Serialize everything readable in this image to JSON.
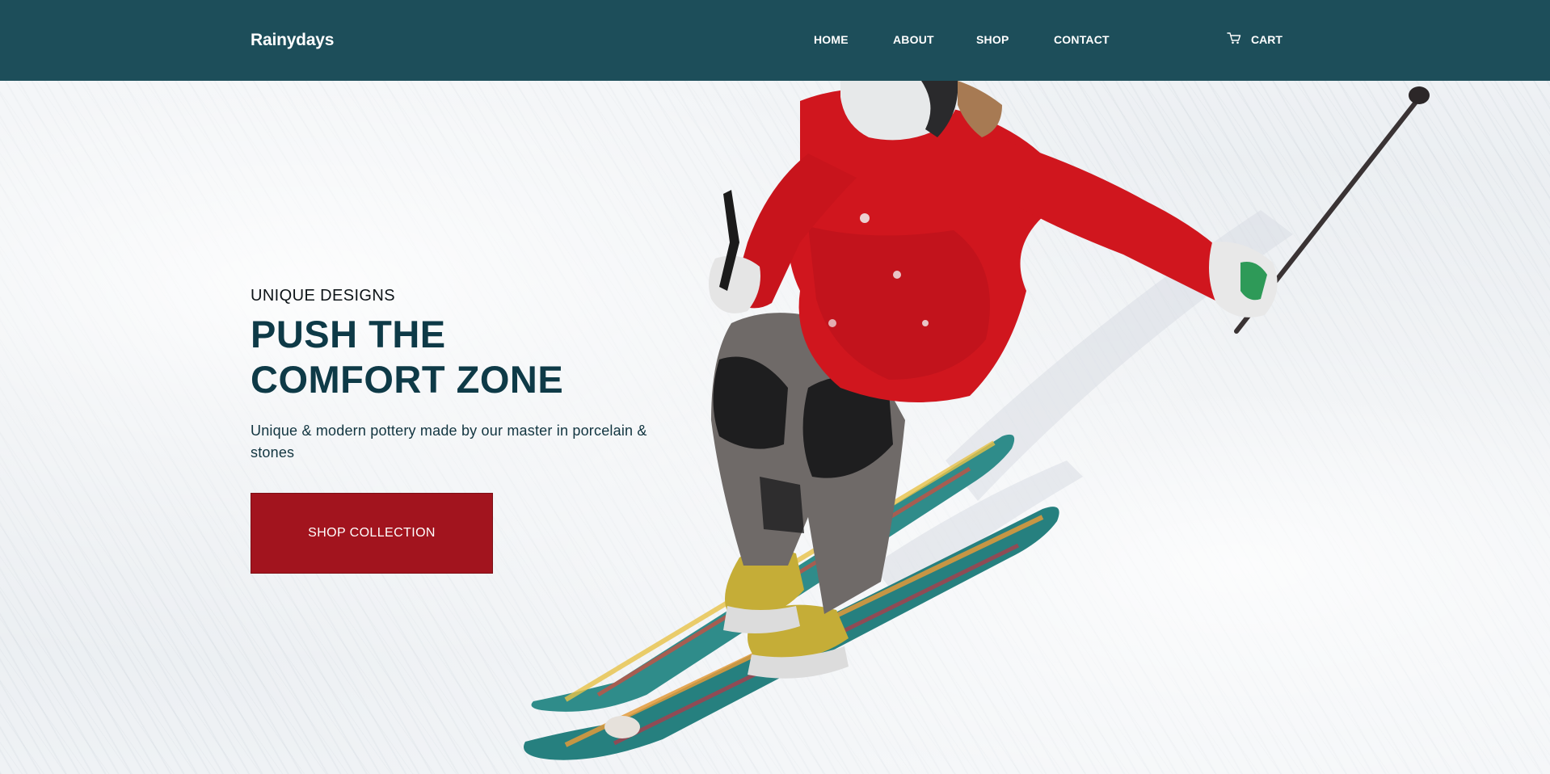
{
  "header": {
    "brand": "Rainydays",
    "nav": [
      {
        "label": "HOME"
      },
      {
        "label": "ABOUT"
      },
      {
        "label": "SHOP"
      },
      {
        "label": "CONTACT"
      }
    ],
    "cart": {
      "label": "CART",
      "icon": "cart-icon"
    }
  },
  "hero": {
    "eyebrow": "UNIQUE DESIGNS",
    "headline_line1": "PUSH THE",
    "headline_line2": "COMFORT ZONE",
    "subtext": "Unique & modern pottery made by our master in porcelain & stones",
    "cta_label": "SHOP COLLECTION"
  },
  "colors": {
    "header_bg": "#1d4e5a",
    "headline": "#0e3a47",
    "cta_bg": "#a2141e",
    "jacket_red": "#d0161e"
  }
}
